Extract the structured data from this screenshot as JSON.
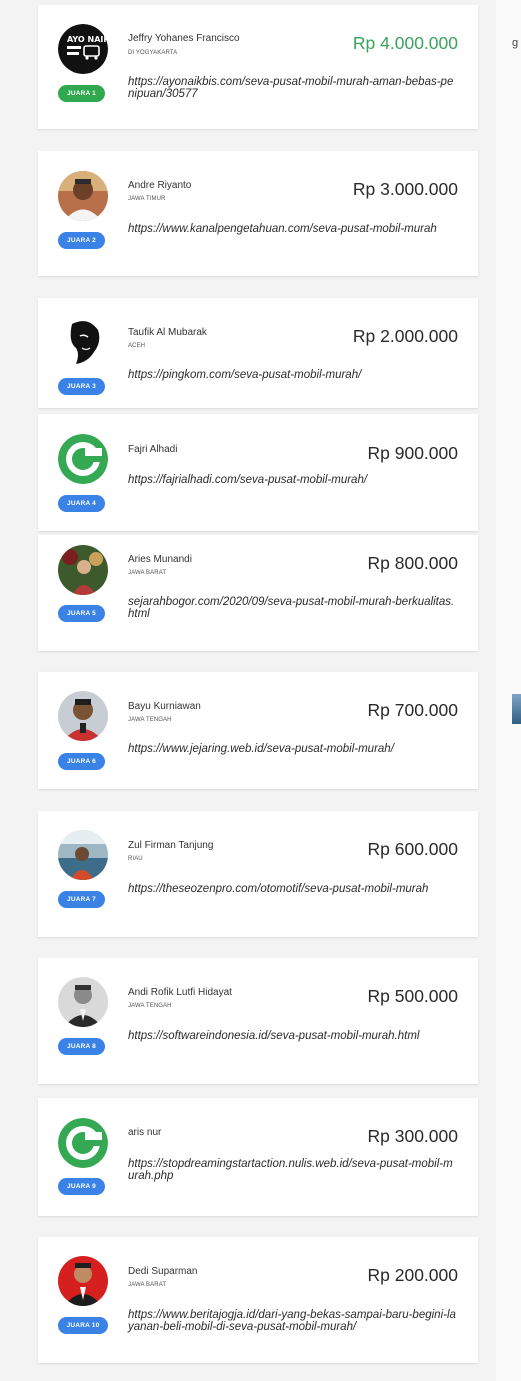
{
  "winners": [
    {
      "name": "Jeffry Yohanes Francisco",
      "region": "DI YOGYAKARTA",
      "amount": "Rp 4.000.000",
      "url": "https://ayonaikbis.com/seva-pusat-mobil-murah-aman-bebas-penipuan/30577",
      "badge": "JUARA 1",
      "avatar_icon": "ayo-naik-bis-logo",
      "avatar_text": "AYO NAIK BIS"
    },
    {
      "name": "Andre Riyanto",
      "region": "JAWA TIMUR",
      "amount": "Rp 3.000.000",
      "url": "https://www.kanalpengetahuan.com/seva-pusat-mobil-murah",
      "badge": "JUARA 2",
      "avatar_icon": "profile-photo"
    },
    {
      "name": "Taufik Al Mubarak",
      "region": "ACEH",
      "amount": "Rp 2.000.000",
      "url": "https://pingkom.com/seva-pusat-mobil-murah/",
      "badge": "JUARA 3",
      "avatar_icon": "silhouette-sketch"
    },
    {
      "name": "Fajri Alhadi",
      "region": "",
      "amount": "Rp 900.000",
      "url": "https://fajrialhadi.com/seva-pusat-mobil-murah/",
      "badge": "JUARA 4",
      "avatar_icon": "green-g-logo"
    },
    {
      "name": "Aries Munandi",
      "region": "JAWA BARAT",
      "amount": "Rp 800.000",
      "url": "sejarahbogor.com/2020/09/seva-pusat-mobil-murah-berkualitas.html",
      "badge": "JUARA 5",
      "avatar_icon": "profile-photo"
    },
    {
      "name": "Bayu Kurniawan",
      "region": "JAWA TENGAH",
      "amount": "Rp 700.000",
      "url": "https://www.jejaring.web.id/seva-pusat-mobil-murah/",
      "badge": "JUARA 6",
      "avatar_icon": "profile-photo"
    },
    {
      "name": "Zul Firman Tanjung",
      "region": "RIAU",
      "amount": "Rp 600.000",
      "url": "https://theseozenpro.com/otomotif/seva-pusat-mobil-murah",
      "badge": "JUARA 7",
      "avatar_icon": "profile-photo"
    },
    {
      "name": "Andi Rofik Lutfi Hidayat",
      "region": "JAWA TENGAH",
      "amount": "Rp 500.000",
      "url": "https://softwareindonesia.id/seva-pusat-mobil-murah.html",
      "badge": "JUARA 8",
      "avatar_icon": "profile-photo"
    },
    {
      "name": "aris nur",
      "region": "",
      "amount": "Rp 300.000",
      "url": "https://stopdreamingstartaction.nulis.web.id/seva-pusat-mobil-murah.php",
      "badge": "JUARA 9",
      "avatar_icon": "green-g-logo"
    },
    {
      "name": "Dedi Suparman",
      "region": "JAWA BARAT",
      "amount": "Rp 200.000",
      "url": "https://www.beritajogja.id/dari-yang-bekas-sampai-baru-begini-layanan-beli-mobil-di-seva-pusat-mobil-murah/",
      "badge": "JUARA 10",
      "avatar_icon": "profile-photo"
    }
  ],
  "side_fragment_text": "g",
  "colors": {
    "badge_first": "#2fa84f",
    "badge_other": "#3b82e6",
    "amount_first": "#3aa55a",
    "amount_other": "#2a2a2a",
    "google_green": "#34a853"
  }
}
